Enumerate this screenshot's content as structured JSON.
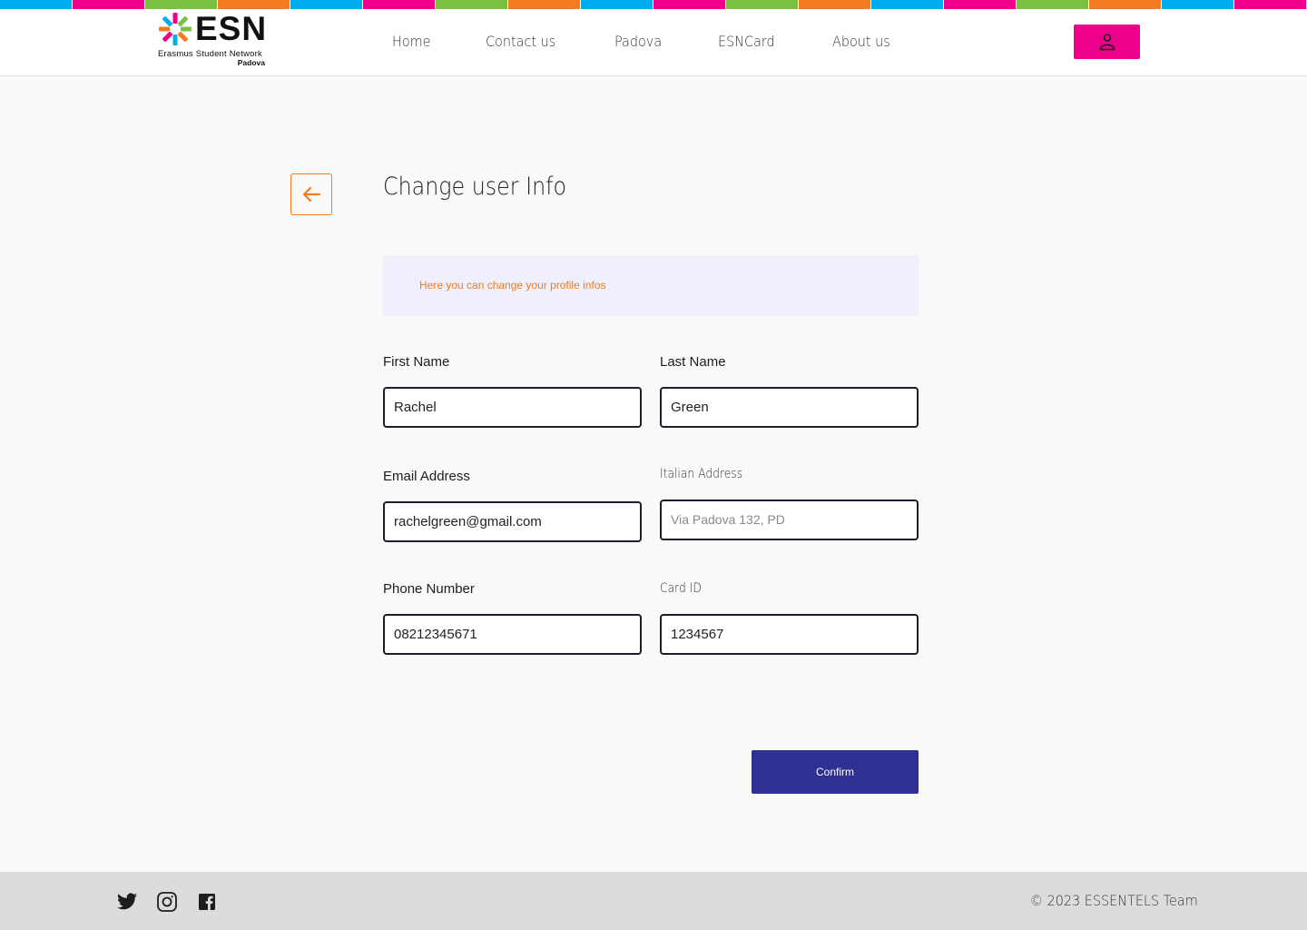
{
  "brand": {
    "name": "ESN",
    "subtitle": "Erasmus Student Network",
    "city": "Padova",
    "stripe_colors": [
      "#00aeef",
      "#ec008c",
      "#7ac143",
      "#f47b20",
      "#00aeef",
      "#ec008c",
      "#7ac143",
      "#f47b20",
      "#00aeef",
      "#ec008c",
      "#7ac143",
      "#f47b20",
      "#00aeef",
      "#ec008c",
      "#7ac143",
      "#f47b20",
      "#00aeef",
      "#ec008c"
    ]
  },
  "nav": {
    "items": [
      {
        "label": "Home"
      },
      {
        "label": "Contact us"
      },
      {
        "label": "Padova"
      },
      {
        "label": "ESNCard"
      },
      {
        "label": "About us"
      }
    ],
    "user_icon": "user-icon"
  },
  "page": {
    "title": "Change user Info",
    "back_icon": "arrow-left-icon",
    "info_text": "Here you can change your profile infos"
  },
  "form": {
    "first_name": {
      "label": "First Name",
      "value": "Rachel"
    },
    "last_name": {
      "label": "Last Name",
      "value": "Green"
    },
    "email": {
      "label": "Email Address",
      "value": "rachelgreen@gmail.com"
    },
    "italian_address": {
      "label": "Italian Address",
      "placeholder": "Via Padova 132, PD"
    },
    "phone": {
      "label": "Phone Number",
      "value": "08212345671"
    },
    "card_id": {
      "label": "Card ID",
      "value": "1234567"
    },
    "confirm_label": "Confirm"
  },
  "footer": {
    "social": [
      "twitter-icon",
      "instagram-icon",
      "facebook-icon"
    ],
    "copyright": "© 2023 ESSENTELS Team"
  },
  "colors": {
    "magenta": "#ec008c",
    "orange": "#f47b20",
    "navy": "#2e3192",
    "info_bg": "#f0f0fc"
  }
}
